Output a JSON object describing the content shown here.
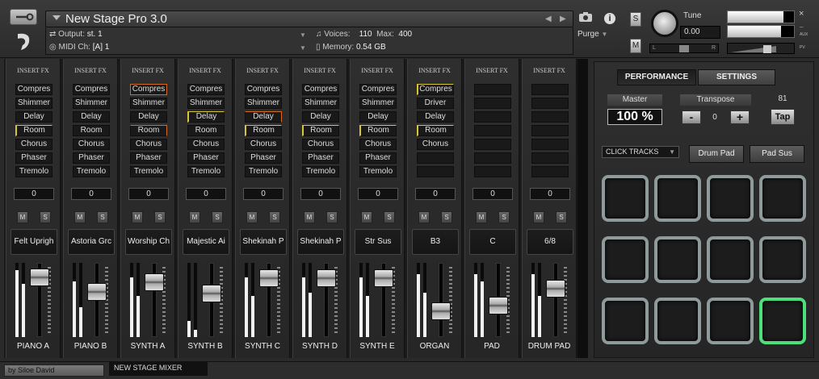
{
  "header": {
    "title": "New Stage Pro 3.0",
    "output_label": "Output:",
    "output_value": "st. 1",
    "midi_label": "MIDI Ch:",
    "midi_value": "[A]  1",
    "voices_label": "Voices:",
    "voices_value": "110",
    "max_label": "Max:",
    "max_value": "400",
    "memory_label": "Memory:",
    "memory_value": "0.54 GB",
    "purge_label": "Purge",
    "s_label": "S",
    "m_label": "M",
    "tune_label": "Tune",
    "tune_value": "0.00",
    "pan_left": "L",
    "pan_right": "R",
    "aux_label": "AUX",
    "pv_label": "PV",
    "close": "×",
    "info": "i",
    "vu_left": 0.84,
    "vu_right": 0.8
  },
  "mixer": {
    "insert_title": "INSERT FX",
    "mute_label": "M",
    "solo_label": "S",
    "channels": [
      {
        "name": "PIANO A",
        "preset": "Felt Uprigh",
        "value": "0",
        "fx": [
          "Compres",
          "Shimmer",
          "Delay",
          "Room",
          "Chorus",
          "Phaser",
          "Tremolo"
        ],
        "hl": [
          "",
          "",
          "",
          "yel",
          "",
          "",
          ""
        ],
        "fader": 0.9,
        "meter_l": 0.9,
        "meter_r": 0.72
      },
      {
        "name": "PIANO B",
        "preset": "Astoria Grc",
        "value": "0",
        "fx": [
          "Compres",
          "Shimmer",
          "Delay",
          "Room",
          "Chorus",
          "Phaser",
          "Tremolo"
        ],
        "hl": [
          "",
          "",
          "",
          "",
          "",
          "",
          ""
        ],
        "fader": 0.65,
        "meter_l": 0.75,
        "meter_r": 0.4
      },
      {
        "name": "SYNTH A",
        "preset": "Worship Ch",
        "value": "0",
        "fx": [
          "Compres",
          "Shimmer",
          "Delay",
          "Room",
          "Chorus",
          "Phaser",
          "Tremolo"
        ],
        "hl": [
          "org",
          "",
          "",
          "orgt",
          "",
          "",
          ""
        ],
        "fader": 0.82,
        "meter_l": 0.8,
        "meter_r": 0.55
      },
      {
        "name": "SYNTH B",
        "preset": "Majestic Ai",
        "value": "0",
        "fx": [
          "Compres",
          "Shimmer",
          "Delay",
          "Room",
          "Chorus",
          "Phaser",
          "Tremolo"
        ],
        "hl": [
          "",
          "",
          "yel",
          "",
          "",
          "",
          ""
        ],
        "fader": 0.62,
        "meter_l": 0.22,
        "meter_r": 0.1
      },
      {
        "name": "SYNTH C",
        "preset": "Shekinah P",
        "value": "0",
        "fx": [
          "Compres",
          "Shimmer",
          "Delay",
          "Room",
          "Chorus",
          "Phaser",
          "Tremolo"
        ],
        "hl": [
          "",
          "",
          "orgt",
          "yel",
          "",
          "",
          ""
        ],
        "fader": 0.88,
        "meter_l": 0.8,
        "meter_r": 0.55
      },
      {
        "name": "SYNTH D",
        "preset": "Shekinah P",
        "value": "0",
        "fx": [
          "Compres",
          "Shimmer",
          "Delay",
          "Room",
          "Chorus",
          "Phaser",
          "Tremolo"
        ],
        "hl": [
          "",
          "",
          "",
          "yel",
          "",
          "",
          ""
        ],
        "fader": 0.88,
        "meter_l": 0.8,
        "meter_r": 0.6
      },
      {
        "name": "SYNTH E",
        "preset": "Str Sus",
        "value": "0",
        "fx": [
          "Compres",
          "Shimmer",
          "Delay",
          "Room",
          "Chorus",
          "Phaser",
          "Tremolo"
        ],
        "hl": [
          "",
          "",
          "",
          "yel",
          "",
          "",
          ""
        ],
        "fader": 0.88,
        "meter_l": 0.8,
        "meter_r": 0.55
      },
      {
        "name": "ORGAN",
        "preset": "B3",
        "value": "0",
        "fx": [
          "Compres",
          "Driver",
          "Delay",
          "Room",
          "Chorus",
          "",
          ""
        ],
        "hl": [
          "yel",
          "",
          "",
          "yel",
          "",
          "",
          ""
        ],
        "fader": 0.3,
        "meter_l": 0.85,
        "meter_r": 0.6
      },
      {
        "name": "PAD",
        "preset": "C",
        "value": "0",
        "fx": [
          "",
          "",
          "",
          "",
          "",
          "",
          ""
        ],
        "hl": [
          "",
          "",
          "",
          "",
          "",
          "",
          ""
        ],
        "fader": 0.4,
        "meter_l": 0.85,
        "meter_r": 0.75
      },
      {
        "name": "DRUM PAD",
        "preset": "6/8",
        "value": "0",
        "fx": [
          "",
          "",
          "",
          "",
          "",
          "",
          ""
        ],
        "hl": [
          "",
          "",
          "",
          "",
          "",
          "",
          ""
        ],
        "fader": 0.7,
        "meter_l": 0.85,
        "meter_r": 0.55
      }
    ]
  },
  "panel": {
    "tab_performance": "PERFORMANCE",
    "tab_settings": "SETTINGS",
    "master_label": "Master",
    "master_value": "100 %",
    "transpose_label": "Transpose",
    "transpose_minus": "-",
    "transpose_value": "0",
    "transpose_plus": "+",
    "bpm": "81",
    "tap_label": "Tap",
    "click_tracks": "CLICK TRACKS",
    "drum_pad_label": "Drum Pad",
    "pad_sus_label": "Pad Sus",
    "active_pad": 11
  },
  "footer": {
    "credit": "by Siloe David",
    "mixer_tab": "NEW STAGE MIXER"
  },
  "colors": {
    "active_pad": "#4de07a",
    "pad_border": "#8f9a9a",
    "fx_yellow": "#d8c43a",
    "fx_orange": "#d56a22"
  }
}
